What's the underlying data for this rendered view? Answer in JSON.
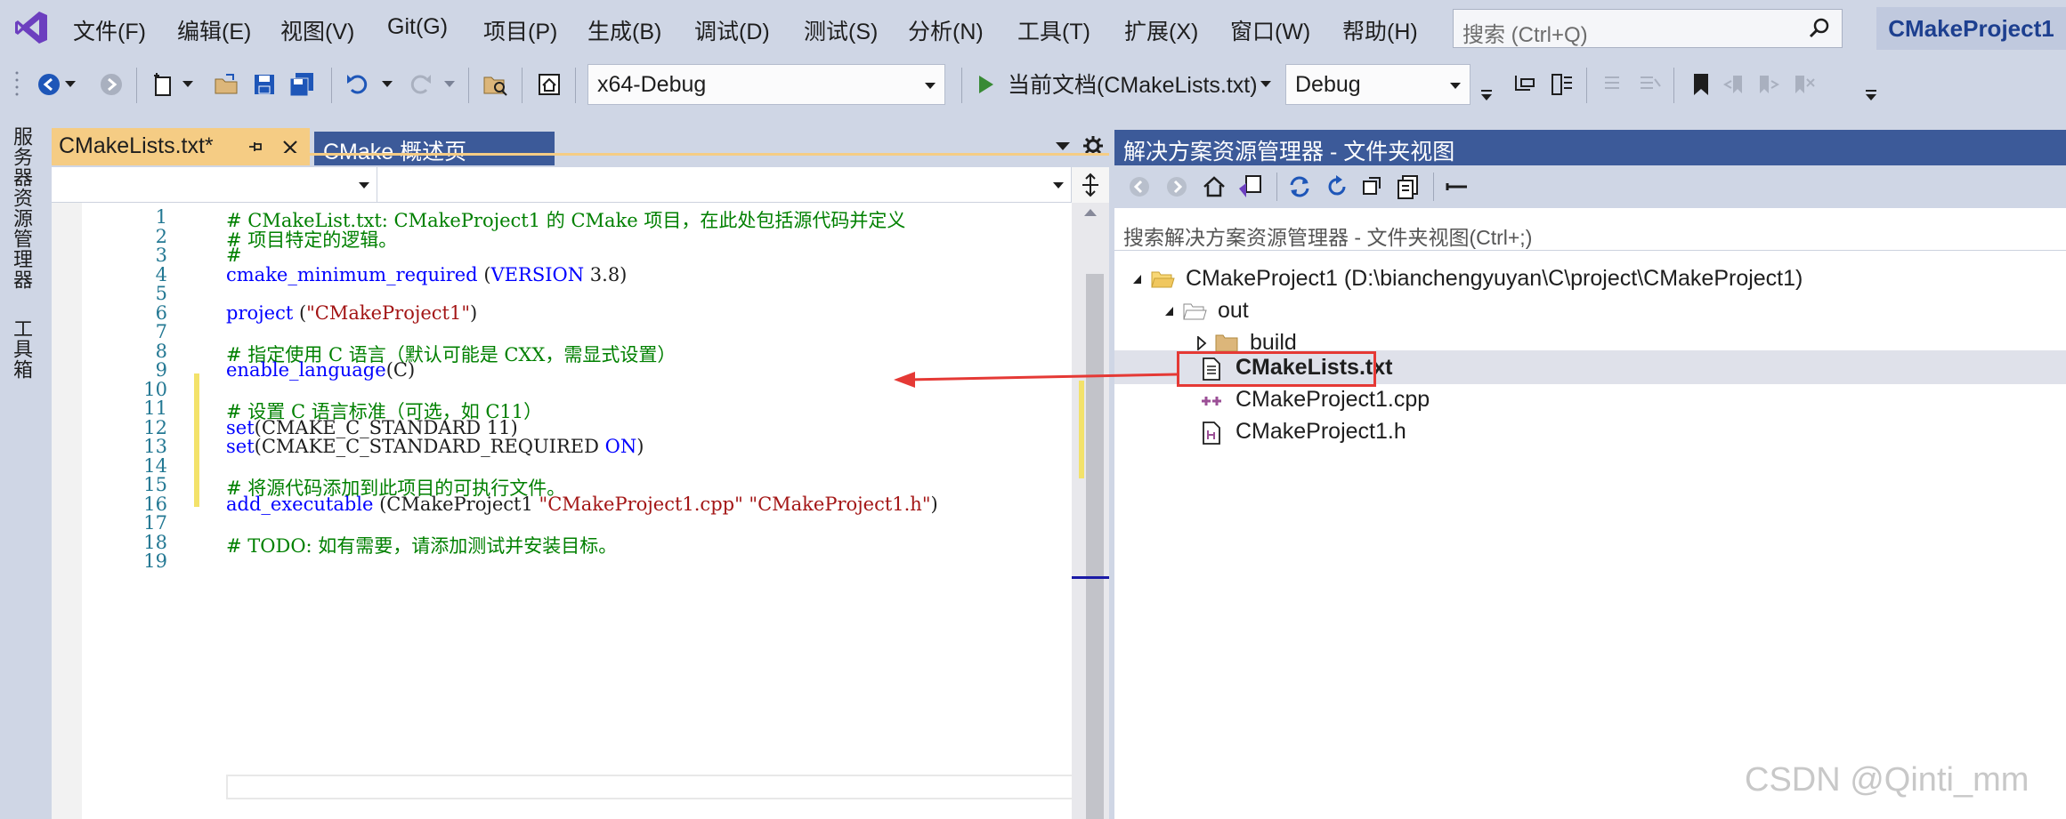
{
  "menu": {
    "items": [
      "文件(F)",
      "编辑(E)",
      "视图(V)",
      "Git(G)",
      "项目(P)",
      "生成(B)",
      "调试(D)",
      "测试(S)",
      "分析(N)",
      "工具(T)",
      "扩展(X)",
      "窗口(W)",
      "帮助(H)"
    ],
    "search_placeholder": "搜索 (Ctrl+Q)",
    "project_name": "CMakeProject1"
  },
  "toolbar": {
    "config": "x64-Debug",
    "run_target": "当前文档(CMakeLists.txt)",
    "build_type": "Debug"
  },
  "left_bar": {
    "server_explorer": "服务器资源管理器",
    "toolbox": "工具箱"
  },
  "editor": {
    "tabs": [
      {
        "label": "CMakeLists.txt*",
        "active": true
      },
      {
        "label": "CMake 概述页",
        "active": false
      }
    ],
    "line_numbers": [
      "1",
      "2",
      "3",
      "4",
      "5",
      "6",
      "7",
      "8",
      "9",
      "10",
      "11",
      "12",
      "13",
      "14",
      "15",
      "16",
      "17",
      "18",
      "19"
    ],
    "code": {
      "l1": "# CMakeList.txt: CMakeProject1 的 CMake 项目，在此处包括源代码并定义",
      "l2": "# 项目特定的逻辑。",
      "l3": "#",
      "l4a": "cmake_minimum_required",
      "l4b": " (",
      "l4c": "VERSION",
      "l4d": " 3.8)",
      "l6a": "project",
      "l6b": " (",
      "l6c": "\"CMakeProject1\"",
      "l6d": ")",
      "l8": "# 指定使用 C 语言（默认可能是 CXX，需显式设置）",
      "l9a": "enable_language",
      "l9b": "(C)",
      "l11": "# 设置 C 语言标准（可选，如 C11）",
      "l12a": "set",
      "l12b": "(CMAKE_C_STANDARD 11)",
      "l13a": "set",
      "l13b": "(CMAKE_C_STANDARD_REQUIRED ",
      "l13c": "ON",
      "l13d": ")",
      "l15": "# 将源代码添加到此项目的可执行文件。",
      "l16a": "add_executable",
      "l16b": " (CMakeProject1 ",
      "l16c": "\"CMakeProject1.cpp\" \"CMakeProject1.h\"",
      "l16d": ")",
      "l18": "# TODO: 如有需要，请添加测试并安装目标。"
    }
  },
  "solution_explorer": {
    "title": "解决方案资源管理器 - 文件夹视图",
    "search_placeholder": "搜索解决方案资源管理器 - 文件夹视图(Ctrl+;)",
    "tree": {
      "root": "CMakeProject1 (D:\\bianchengyuyan\\C\\project\\CMakeProject1)",
      "out": "out",
      "build": "build",
      "cmakelists": "CMakeLists.txt",
      "cpp": "CMakeProject1.cpp",
      "h": "CMakeProject1.h"
    }
  },
  "watermark": "CSDN @Qinti_mm",
  "colors": {
    "chrome": "#cfd6e5",
    "active_tab": "#f5cc84",
    "title_blue": "#3c5a99",
    "annotation_red": "#e53935"
  }
}
